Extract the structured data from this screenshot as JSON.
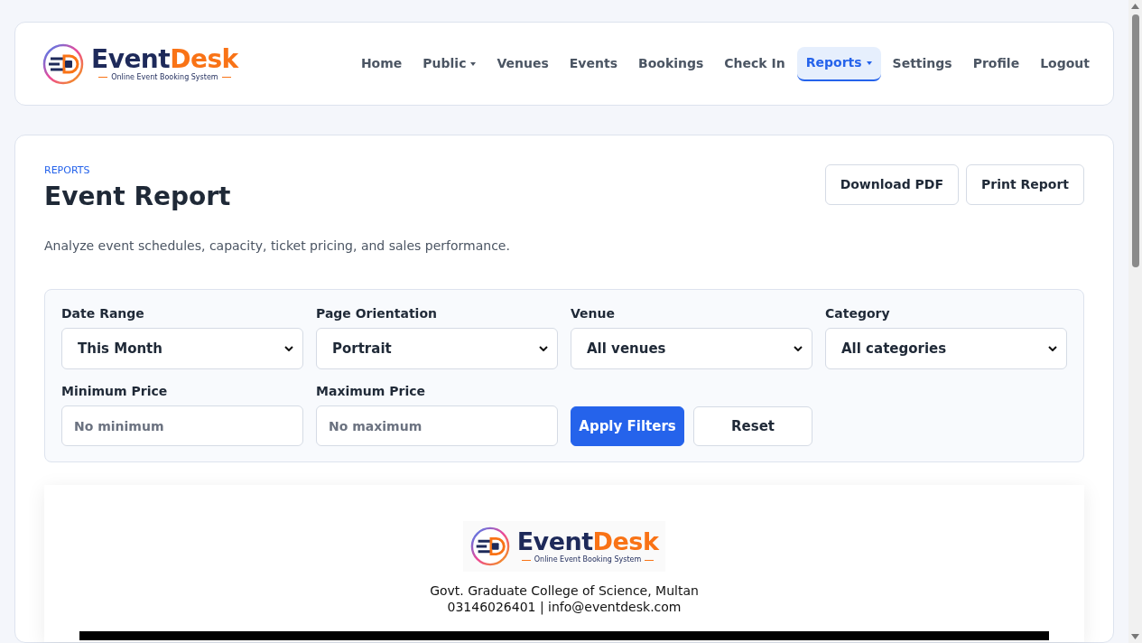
{
  "logo": {
    "name_first": "Event",
    "name_second": "Desk",
    "tagline": "Online Event Booking System"
  },
  "nav": [
    {
      "label": "Home",
      "selected": false,
      "dropdown": false
    },
    {
      "label": "Public",
      "selected": false,
      "dropdown": true
    },
    {
      "label": "Venues",
      "selected": false,
      "dropdown": false
    },
    {
      "label": "Events",
      "selected": false,
      "dropdown": false
    },
    {
      "label": "Bookings",
      "selected": false,
      "dropdown": false
    },
    {
      "label": "Check In",
      "selected": false,
      "dropdown": false
    },
    {
      "label": "Reports",
      "selected": true,
      "dropdown": true
    },
    {
      "label": "Settings",
      "selected": false,
      "dropdown": false
    },
    {
      "label": "Profile",
      "selected": false,
      "dropdown": false
    },
    {
      "label": "Logout",
      "selected": false,
      "dropdown": false
    }
  ],
  "header": {
    "eyebrow": "REPORTS",
    "title": "Event Report",
    "subtitle": "Analyze event schedules, capacity, ticket pricing, and sales performance.",
    "buttons": [
      "Download PDF",
      "Print Report"
    ]
  },
  "filters": [
    {
      "kind": "select",
      "label": "Date Range",
      "value": "This Month"
    },
    {
      "kind": "select",
      "label": "Page Orientation",
      "value": "Portrait"
    },
    {
      "kind": "select",
      "label": "Venue",
      "value": "All venues"
    },
    {
      "kind": "select",
      "label": "Category",
      "value": "All categories"
    },
    {
      "kind": "input",
      "label": "Minimum Price",
      "placeholder": "No minimum"
    },
    {
      "kind": "input",
      "label": "Maximum Price",
      "placeholder": "No maximum"
    }
  ],
  "filter_buttons": [
    {
      "label": "Apply Filters",
      "kind": "primary"
    },
    {
      "label": "Reset",
      "kind": "secondary"
    }
  ],
  "preview": {
    "logo": {
      "name_first": "Event",
      "name_second": "Desk",
      "tagline": "Online Event Booking System"
    },
    "address": "Govt. Graduate College of Science, Multan",
    "contact": "03146026401 | info@eventdesk.com"
  }
}
